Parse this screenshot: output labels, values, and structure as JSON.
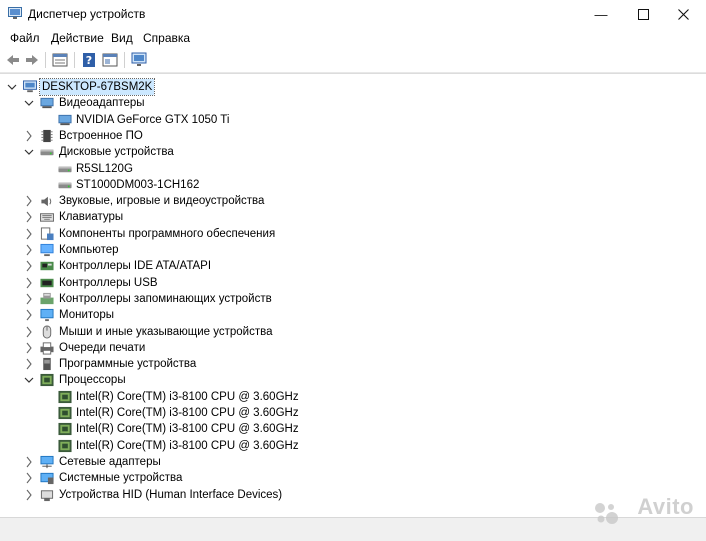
{
  "window": {
    "title": "Диспетчер устройств"
  },
  "menu": [
    "Файл",
    "Действие",
    "Вид",
    "Справка"
  ],
  "tree": {
    "root": "DESKTOP-67BSM2K",
    "categories": [
      {
        "label": "Видеоадаптеры",
        "icon": "display-adapter-icon",
        "expanded": true,
        "children": [
          "NVIDIA GeForce GTX 1050 Ti"
        ]
      },
      {
        "label": "Встроенное ПО",
        "icon": "firmware-icon",
        "expanded": false
      },
      {
        "label": "Дисковые устройства",
        "icon": "disk-drive-icon",
        "expanded": true,
        "children": [
          "R5SL120G",
          "ST1000DM003-1CH162"
        ]
      },
      {
        "label": "Звуковые, игровые и видеоустройства",
        "icon": "speaker-icon",
        "expanded": false
      },
      {
        "label": "Клавиатуры",
        "icon": "keyboard-icon",
        "expanded": false
      },
      {
        "label": "Компоненты программного обеспечения",
        "icon": "software-component-icon",
        "expanded": false
      },
      {
        "label": "Компьютер",
        "icon": "computer-icon",
        "expanded": false
      },
      {
        "label": "Контроллеры IDE ATA/ATAPI",
        "icon": "ide-controller-icon",
        "expanded": false
      },
      {
        "label": "Контроллеры USB",
        "icon": "usb-icon",
        "expanded": false
      },
      {
        "label": "Контроллеры запоминающих устройств",
        "icon": "storage-controller-icon",
        "expanded": false
      },
      {
        "label": "Мониторы",
        "icon": "monitor-icon",
        "expanded": false
      },
      {
        "label": "Мыши и иные указывающие устройства",
        "icon": "mouse-icon",
        "expanded": false
      },
      {
        "label": "Очереди печати",
        "icon": "printer-icon",
        "expanded": false
      },
      {
        "label": "Программные устройства",
        "icon": "software-device-icon",
        "expanded": false
      },
      {
        "label": "Процессоры",
        "icon": "cpu-icon",
        "expanded": true,
        "children": [
          "Intel(R) Core(TM) i3-8100 CPU @ 3.60GHz",
          "Intel(R) Core(TM) i3-8100 CPU @ 3.60GHz",
          "Intel(R) Core(TM) i3-8100 CPU @ 3.60GHz",
          "Intel(R) Core(TM) i3-8100 CPU @ 3.60GHz"
        ]
      },
      {
        "label": "Сетевые адаптеры",
        "icon": "network-adapter-icon",
        "expanded": false
      },
      {
        "label": "Системные устройства",
        "icon": "system-device-icon",
        "expanded": false
      },
      {
        "label": "Устройства HID (Human Interface Devices)",
        "icon": "hid-icon",
        "expanded": false
      }
    ]
  },
  "watermark": "Avito"
}
